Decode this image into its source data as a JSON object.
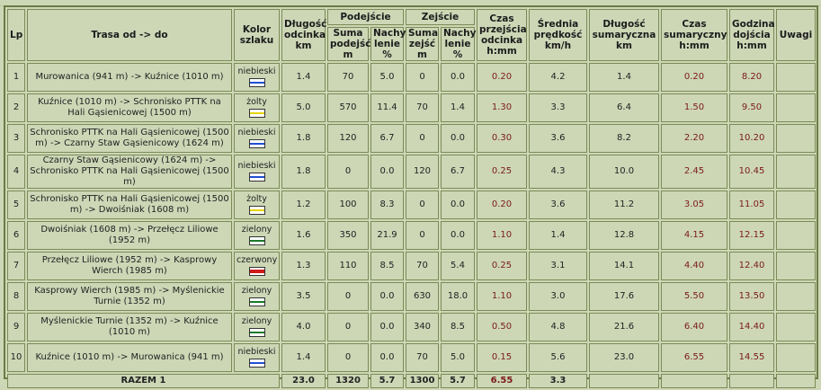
{
  "headers": {
    "lp": "Lp",
    "route": "Trasa od -> do",
    "color": "Kolor szlaku",
    "segment_length": "Długość odcinka km",
    "ascent_group": "Podejście",
    "ascent_sum": "Suma podejść m",
    "ascent_slope": "Nachy lenie %",
    "descent_group": "Zejście",
    "descent_sum": "Suma zejść m",
    "descent_slope": "Nachy lenie %",
    "segment_time": "Czas przejścia odcinka h:mm",
    "avg_speed": "Średnia prędkość km/h",
    "total_length": "Długość sumaryczna km",
    "total_time": "Czas sumaryczny h:mm",
    "arrival_time": "Godzina dojścia h:mm",
    "notes": "Uwagi"
  },
  "colors": {
    "niebieski": "#1f4fd1",
    "zolty": "#e7d400",
    "zielony": "#1a7a2a",
    "czerwony": "#d01a1a"
  },
  "rows": [
    {
      "lp": "1",
      "route": "Murowanica (941 m) -> Kuźnice (1010 m)",
      "color_label": "niebieski",
      "color_key": "niebieski",
      "len": "1.4",
      "asc": "70",
      "asc_slope": "5.0",
      "desc": "0",
      "desc_slope": "0.0",
      "time": "0.20",
      "speed": "4.2",
      "sum_len": "1.4",
      "sum_time": "0.20",
      "arrive": "8.20",
      "notes": ""
    },
    {
      "lp": "2",
      "route": "Kuźnice (1010 m) -> Schronisko PTTK na Hali Gąsienicowej (1500 m)",
      "color_label": "żolty",
      "color_key": "zolty",
      "len": "5.0",
      "asc": "570",
      "asc_slope": "11.4",
      "desc": "70",
      "desc_slope": "1.4",
      "time": "1.30",
      "speed": "3.3",
      "sum_len": "6.4",
      "sum_time": "1.50",
      "arrive": "9.50",
      "notes": ""
    },
    {
      "lp": "3",
      "route": "Schronisko PTTK na Hali Gąsienicowej (1500 m) -> Czarny Staw Gąsienicowy (1624 m)",
      "color_label": "niebieski",
      "color_key": "niebieski",
      "len": "1.8",
      "asc": "120",
      "asc_slope": "6.7",
      "desc": "0",
      "desc_slope": "0.0",
      "time": "0.30",
      "speed": "3.6",
      "sum_len": "8.2",
      "sum_time": "2.20",
      "arrive": "10.20",
      "notes": ""
    },
    {
      "lp": "4",
      "route": "Czarny Staw Gąsienicowy (1624 m) -> Schronisko PTTK na Hali Gąsienicowej (1500 m)",
      "color_label": "niebieski",
      "color_key": "niebieski",
      "len": "1.8",
      "asc": "0",
      "asc_slope": "0.0",
      "desc": "120",
      "desc_slope": "6.7",
      "time": "0.25",
      "speed": "4.3",
      "sum_len": "10.0",
      "sum_time": "2.45",
      "arrive": "10.45",
      "notes": ""
    },
    {
      "lp": "5",
      "route": "Schronisko PTTK na Hali Gąsienicowej (1500 m) -> Dwoiśniak (1608 m)",
      "color_label": "żolty",
      "color_key": "zolty",
      "len": "1.2",
      "asc": "100",
      "asc_slope": "8.3",
      "desc": "0",
      "desc_slope": "0.0",
      "time": "0.20",
      "speed": "3.6",
      "sum_len": "11.2",
      "sum_time": "3.05",
      "arrive": "11.05",
      "notes": ""
    },
    {
      "lp": "6",
      "route": "Dwoiśniak (1608 m) -> Przełęcz Liliowe (1952 m)",
      "color_label": "zielony",
      "color_key": "zielony",
      "len": "1.6",
      "asc": "350",
      "asc_slope": "21.9",
      "desc": "0",
      "desc_slope": "0.0",
      "time": "1.10",
      "speed": "1.4",
      "sum_len": "12.8",
      "sum_time": "4.15",
      "arrive": "12.15",
      "notes": ""
    },
    {
      "lp": "7",
      "route": "Przełęcz Liliowe (1952 m) -> Kasprowy Wierch (1985 m)",
      "color_label": "czerwony",
      "color_key": "czerwony",
      "len": "1.3",
      "asc": "110",
      "asc_slope": "8.5",
      "desc": "70",
      "desc_slope": "5.4",
      "time": "0.25",
      "speed": "3.1",
      "sum_len": "14.1",
      "sum_time": "4.40",
      "arrive": "12.40",
      "notes": ""
    },
    {
      "lp": "8",
      "route": "Kasprowy Wierch (1985 m) -> Myślenickie Turnie (1352 m)",
      "color_label": "zielony",
      "color_key": "zielony",
      "len": "3.5",
      "asc": "0",
      "asc_slope": "0.0",
      "desc": "630",
      "desc_slope": "18.0",
      "time": "1.10",
      "speed": "3.0",
      "sum_len": "17.6",
      "sum_time": "5.50",
      "arrive": "13.50",
      "notes": ""
    },
    {
      "lp": "9",
      "route": "Myślenickie Turnie (1352 m) -> Kuźnice (1010 m)",
      "color_label": "zielony",
      "color_key": "zielony",
      "len": "4.0",
      "asc": "0",
      "asc_slope": "0.0",
      "desc": "340",
      "desc_slope": "8.5",
      "time": "0.50",
      "speed": "4.8",
      "sum_len": "21.6",
      "sum_time": "6.40",
      "arrive": "14.40",
      "notes": ""
    },
    {
      "lp": "10",
      "route": "Kuźnice (1010 m) -> Murowanica (941 m)",
      "color_label": "niebieski",
      "color_key": "niebieski",
      "len": "1.4",
      "asc": "0",
      "asc_slope": "0.0",
      "desc": "70",
      "desc_slope": "5.0",
      "time": "0.15",
      "speed": "5.6",
      "sum_len": "23.0",
      "sum_time": "6.55",
      "arrive": "14.55",
      "notes": ""
    }
  ],
  "total": {
    "label": "RAZEM 1",
    "len": "23.0",
    "asc": "1320",
    "asc_slope": "5.7",
    "desc": "1300",
    "desc_slope": "5.7",
    "time": "6.55",
    "speed": "3.3"
  }
}
